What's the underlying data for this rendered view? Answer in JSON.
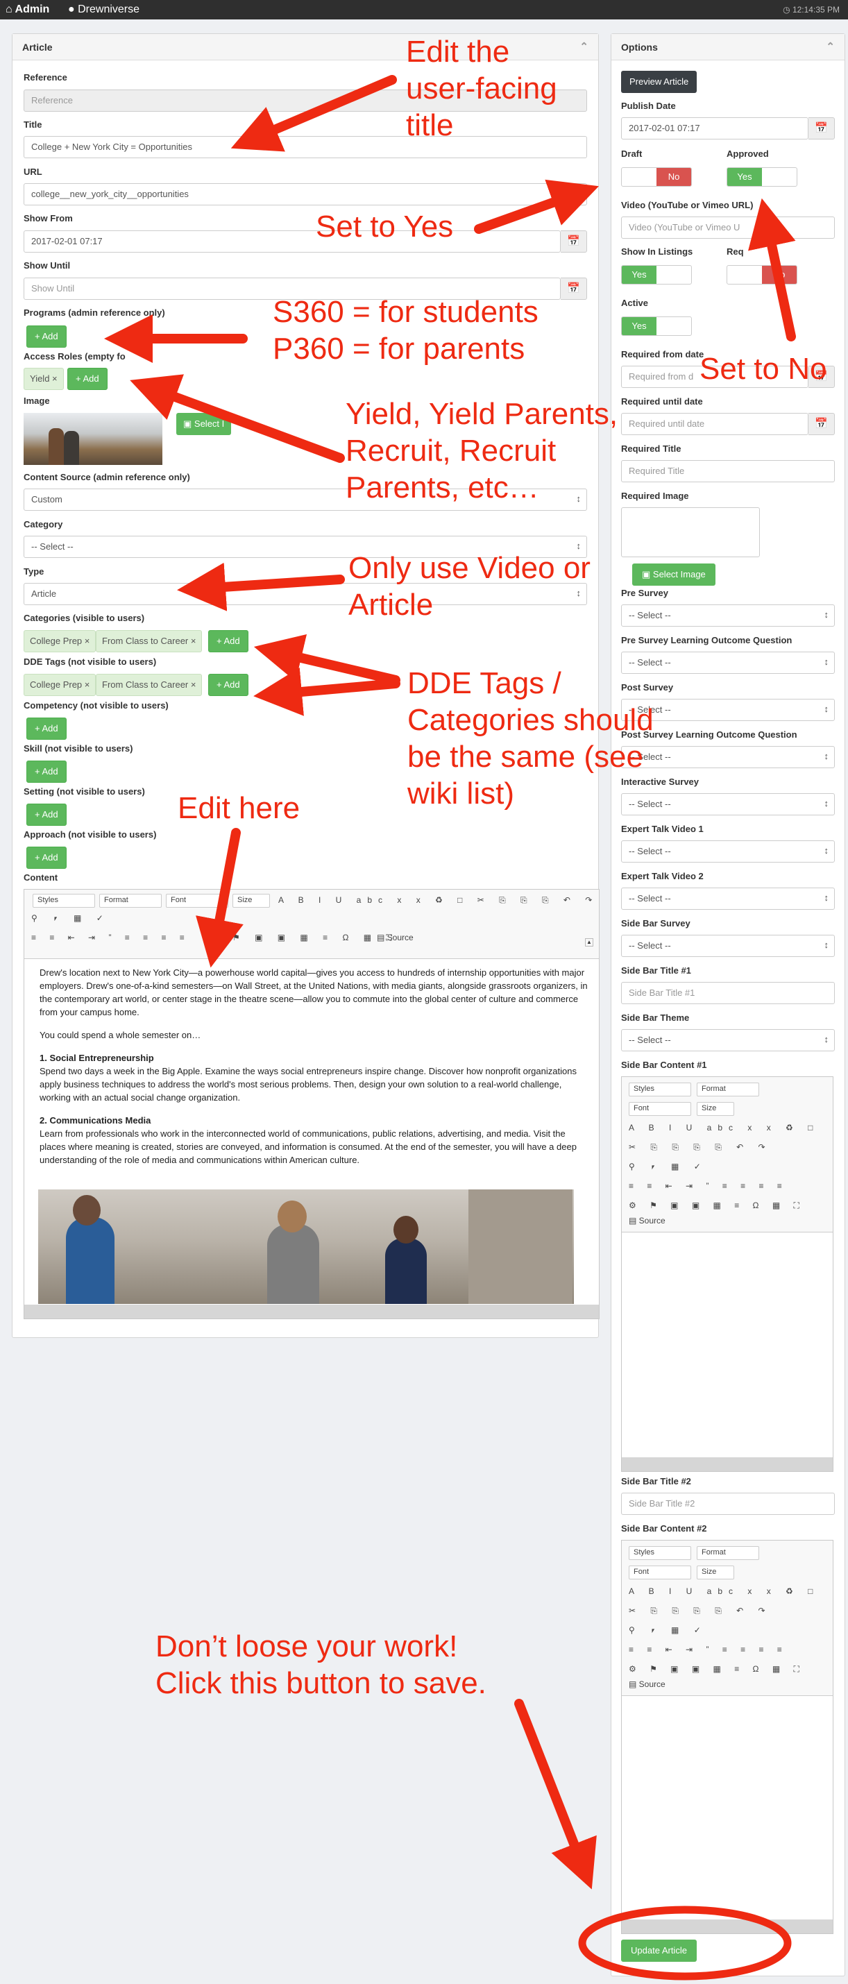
{
  "topbar": {
    "admin": "Admin",
    "site": "Drewniverse",
    "time": "12:14:35 PM"
  },
  "article": {
    "title": "Article",
    "reference_label": "Reference",
    "reference_placeholder": "Reference",
    "title_label": "Title",
    "title_value": "College + New York City = Opportunities",
    "url_label": "URL",
    "url_value": "college__new_york_city__opportunities",
    "show_from_label": "Show From",
    "show_from_value": "2017-02-01 07:17",
    "show_until_label": "Show Until",
    "show_until_placeholder": "Show Until",
    "programs_label": "Programs (admin reference only)",
    "access_label": "Access Roles (empty fo",
    "image_label": "Image",
    "select_image": "Select I",
    "content_source_label": "Content Source (admin reference only)",
    "content_source_value": "Custom",
    "category_label": "Category",
    "category_value": "-- Select --",
    "type_label": "Type",
    "type_value": "Article",
    "categories_label": "Categories (visible to users)",
    "dde_label": "DDE Tags (not visible to users)",
    "competency_label": "Competency (not visible to users)",
    "skill_label": "Skill (not visible to users)",
    "setting_label": "Setting (not visible to users)",
    "approach_label": "Approach (not visible to users)",
    "content_label": "Content",
    "add": "+ Add",
    "tag_yield": "Yield ×",
    "tag_college_prep": "College Prep ×",
    "tag_class_to_career": "From Class to Career ×"
  },
  "editor": {
    "styles": "Styles",
    "format": "Format",
    "font": "Font",
    "size": "Size",
    "source": "Source"
  },
  "content": {
    "p1": "Drew's location next to New York City—a powerhouse world capital—gives you access to hundreds of internship opportunities with major employers. Drew's one-of-a-kind semesters—on Wall Street, at the United Nations, with media giants, alongside grassroots organizers, in the contemporary art world, or center stage in the theatre scene—allow you to commute into the global center of culture and commerce from your campus home.",
    "p2": "You could spend a whole semester on…",
    "h1": "1. Social Entrepreneurship",
    "p3": "Spend two days a week in the Big Apple. Examine the ways social entrepreneurs inspire change. Discover how nonprofit organizations apply business techniques to address the world's most serious problems. Then, design your own solution to a real-world challenge, working with an actual social change organization.",
    "h2": "2. Communications Media",
    "p4": "Learn from professionals who work in the interconnected world of communications, public relations, advertising, and media. Visit the places where meaning is created, stories are conveyed, and information is consumed. At the end of the semester, you will have a deep understanding of the role of media and communications within American culture."
  },
  "options": {
    "title": "Options",
    "preview": "Preview Article",
    "publish_label": "Publish Date",
    "publish_value": "2017-02-01 07:17",
    "draft_label": "Draft",
    "draft_value": "No",
    "approved_label": "Approved",
    "approved_value": "Yes",
    "video_label": "Video (YouTube or Vimeo URL)",
    "video_placeholder": "Video (YouTube or Vimeo U",
    "listings_label": "Show In Listings",
    "listings_value": "Yes",
    "req_label": "Req",
    "active_label": "Active",
    "active_value": "Yes",
    "req_from_label": "Required from date",
    "req_from_placeholder": "Required from d",
    "req_until_label": "Required until date",
    "req_until_placeholder": "Required until date",
    "req_title_label": "Required Title",
    "req_title_placeholder": "Required Title",
    "req_image_label": "Required Image",
    "select_image": "Select Image",
    "pre_survey_label": "Pre Survey",
    "pre_lo_label": "Pre Survey Learning Outcome Question",
    "post_survey_label": "Post Survey",
    "post_lo_label": "Post Survey Learning Outcome Question",
    "interactive_label": "Interactive Survey",
    "expert1_label": "Expert Talk Video 1",
    "expert2_label": "Expert Talk Video 2",
    "sidebar_survey_label": "Side Bar Survey",
    "sb_title1_label": "Side Bar Title #1",
    "sb_title1_placeholder": "Side Bar Title #1",
    "sb_theme_label": "Side Bar Theme",
    "sb_content1_label": "Side Bar Content #1",
    "sb_title2_label": "Side Bar Title #2",
    "sb_title2_placeholder": "Side Bar Title #2",
    "sb_content2_label": "Side Bar Content #2",
    "select": "-- Select --",
    "update": "Update Article"
  },
  "annotations": {
    "a1": "Edit the\nuser-facing\ntitle",
    "a2": "Set to Yes",
    "a3": "Set to No",
    "a4": "S360 = for students\nP360 = for parents",
    "a5": "Yield, Yield Parents,\nRecruit, Recruit\nParents, etc…",
    "a6": "Only use Video or\nArticle",
    "a7": "DDE Tags /\nCategories should\nbe the same (see\nwiki list)",
    "a8": "Edit here",
    "a9": "Don’t loose your work!\nClick this button to save."
  }
}
